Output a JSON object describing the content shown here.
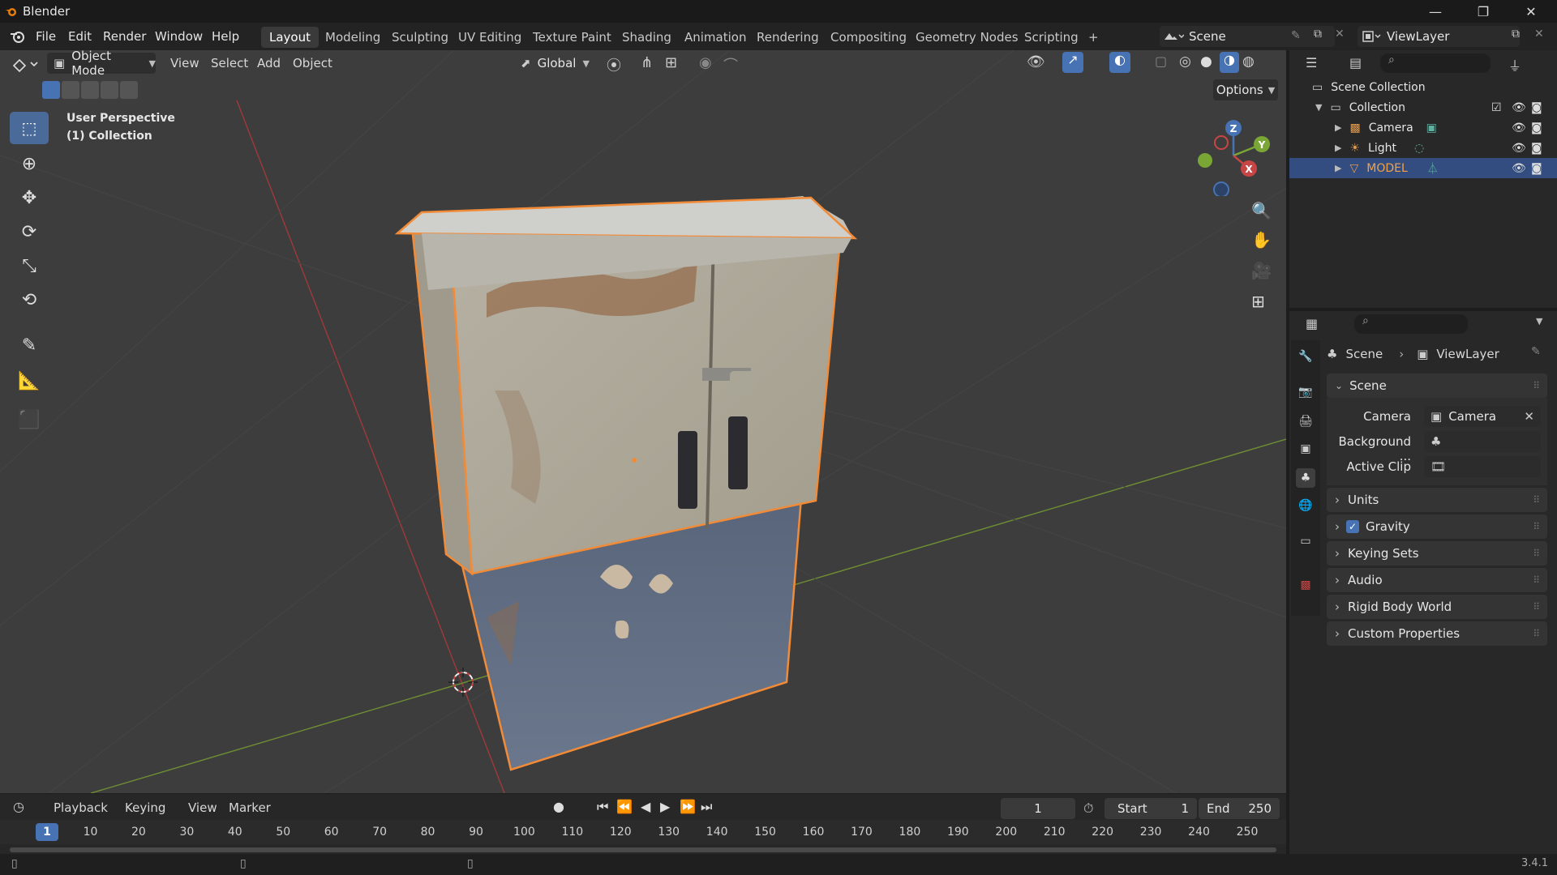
{
  "window": {
    "title": "Blender",
    "min": "—",
    "max": "❐",
    "close": "✕"
  },
  "menu": [
    "File",
    "Edit",
    "Render",
    "Window",
    "Help"
  ],
  "workspaces": [
    "Layout",
    "Modeling",
    "Sculpting",
    "UV Editing",
    "Texture Paint",
    "Shading",
    "Animation",
    "Rendering",
    "Compositing",
    "Geometry Nodes",
    "Scripting",
    "+"
  ],
  "active_workspace": "Layout",
  "scene_field": "Scene",
  "viewlayer_field": "ViewLayer",
  "viewport_header": {
    "mode": "Object Mode",
    "view": "View",
    "select": "Select",
    "add": "Add",
    "object": "Object",
    "orientation": "Global",
    "options": "Options"
  },
  "viewport": {
    "perspective": "User Perspective",
    "collection": "(1) Collection",
    "gizmo": {
      "z": "Z",
      "y": "Y",
      "x": "X"
    }
  },
  "outliner": {
    "root": "Scene Collection",
    "collection": "Collection",
    "items": [
      "Camera",
      "Light",
      "MODEL"
    ],
    "selected": "MODEL"
  },
  "properties": {
    "breadcrumb": {
      "scene": "Scene",
      "viewlayer": "ViewLayer"
    },
    "scene_panel": "Scene",
    "camera_label": "Camera",
    "camera_value": "Camera",
    "background_label": "Background ...",
    "active_clip_label": "Active Clip",
    "panels": [
      "Units",
      "Gravity",
      "Keying Sets",
      "Audio",
      "Rigid Body World",
      "Custom Properties"
    ],
    "gravity_checked": true
  },
  "timeline": {
    "playback": "Playback",
    "keying": "Keying",
    "view": "View",
    "marker": "Marker",
    "current_frame": "1",
    "start_label": "Start",
    "start": "1",
    "end_label": "End",
    "end": "250",
    "ruler": [
      "1",
      "10",
      "20",
      "30",
      "40",
      "50",
      "60",
      "70",
      "80",
      "90",
      "100",
      "110",
      "120",
      "130",
      "140",
      "150",
      "160",
      "170",
      "180",
      "190",
      "200",
      "210",
      "220",
      "230",
      "240",
      "250"
    ]
  },
  "status": {
    "version": "3.4.1"
  },
  "colors": {
    "accent_blue": "#4772b3",
    "selection_orange": "#f28b38",
    "x_axis": "#c84545",
    "y_axis": "#7aa635"
  }
}
